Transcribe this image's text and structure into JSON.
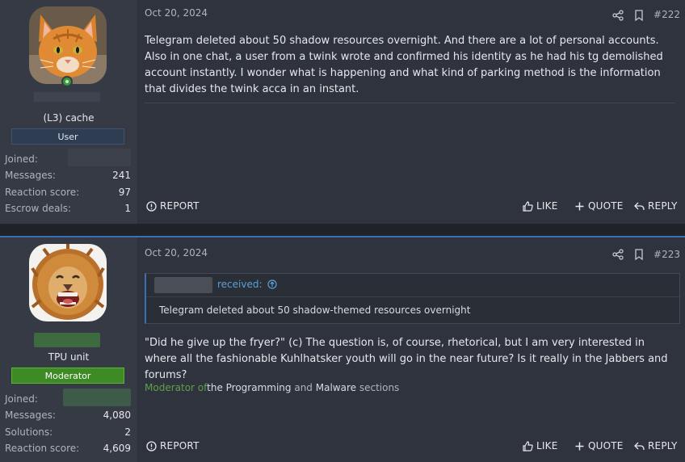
{
  "posts": [
    {
      "author": {
        "title": "(L3) cache",
        "role": "User",
        "avatar": "orange-cat-avatar",
        "stats": [
          {
            "label": "Joined:",
            "value": ""
          },
          {
            "label": "Messages:",
            "value": "241"
          },
          {
            "label": "Reaction score:",
            "value": "97"
          },
          {
            "label": "Escrow deals:",
            "value": "1"
          }
        ]
      },
      "date": "Oct 20, 2024",
      "number": "#222",
      "body": "Telegram deleted about 50 shadow resources overnight. And there are a lot of personal accounts. Also in one chat, a user from a twink wrote and confirmed his identity as he had his tg demolished account instantly. I wonder what is happening and what kind of parking method is the information that divides the twink acca in an instant.",
      "actions": {
        "report": "REPORT",
        "like": "LIKE",
        "quote": "QUOTE",
        "reply": "REPLY"
      }
    },
    {
      "author": {
        "title": "TPU unit",
        "role": "Moderator",
        "avatar": "laughing-lion-avatar",
        "stats": [
          {
            "label": "Joined:",
            "value": ""
          },
          {
            "label": "Messages:",
            "value": "4,080"
          },
          {
            "label": "Solutions:",
            "value": "2"
          },
          {
            "label": "Reaction score:",
            "value": "4,609"
          }
        ]
      },
      "date": "Oct 20, 2024",
      "number": "#223",
      "quote": {
        "author_suffix": "received:",
        "text": "Telegram deleted about 50 shadow-themed resources overnight"
      },
      "body": "\"Did he give up the fryer?\" (c) The question is, of course, rhetorical, but I am very interested in where all the fashionable Kuhlhatsker youth will go in the near future? Is it really in the Jabbers and forums?",
      "signature": {
        "prefix": "Moderator of",
        "part1": "the Programming",
        "and": " and ",
        "part2": "Malware",
        "suffix": " sections"
      },
      "actions": {
        "report": "REPORT",
        "like": "LIKE",
        "quote": "QUOTE",
        "reply": "REPLY"
      }
    }
  ],
  "colors": {
    "accent": "#3b6fb3",
    "moderator_badge": "#3e8a24",
    "online": "#3a9a3a",
    "link": "#5aa0d8"
  }
}
